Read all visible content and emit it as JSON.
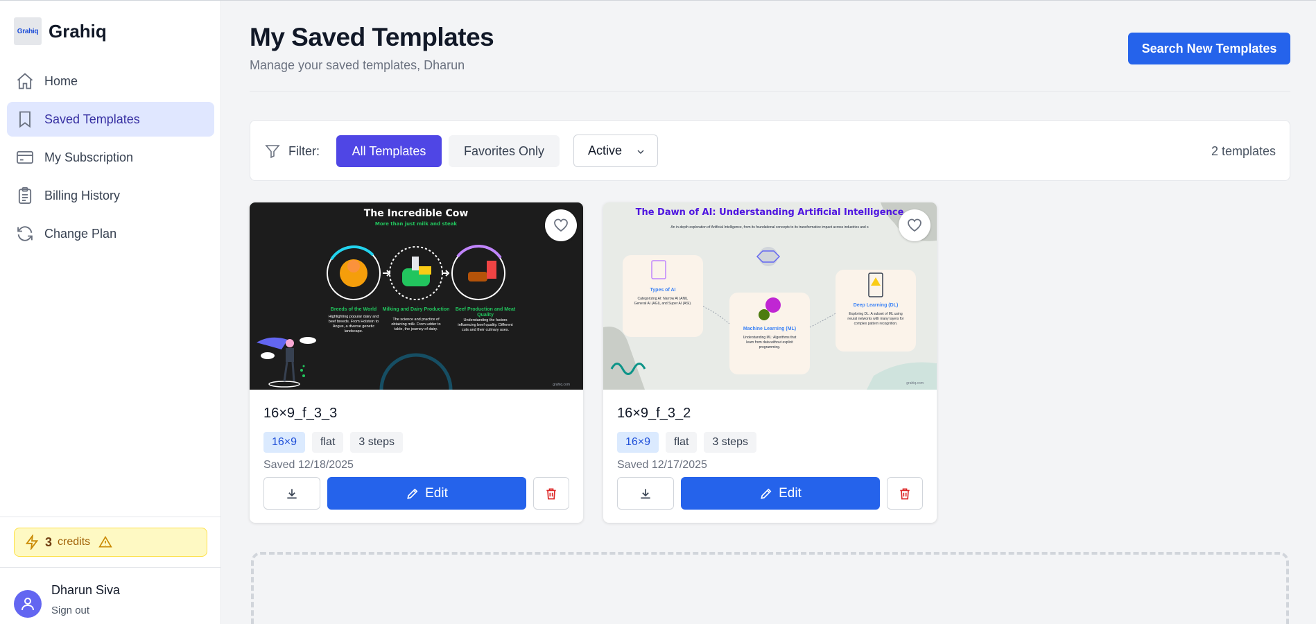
{
  "brand": {
    "logo_text": "Grahiq",
    "name": "Grahiq"
  },
  "nav": [
    {
      "label": "Home",
      "icon": "home-icon",
      "active": false
    },
    {
      "label": "Saved Templates",
      "icon": "bookmark-icon",
      "active": true
    },
    {
      "label": "My Subscription",
      "icon": "credit-card-icon",
      "active": false
    },
    {
      "label": "Billing History",
      "icon": "clipboard-icon",
      "active": false
    },
    {
      "label": "Change Plan",
      "icon": "refresh-icon",
      "active": false
    }
  ],
  "credits": {
    "count": "3",
    "label": "credits"
  },
  "user": {
    "name": "Dharun Siva",
    "signout": "Sign out"
  },
  "header": {
    "title": "My Saved Templates",
    "subtitle": "Manage your saved templates, Dharun",
    "search_button": "Search New Templates"
  },
  "filter": {
    "label": "Filter:",
    "all": "All Templates",
    "favorites": "Favorites Only",
    "status": "Active",
    "count": "2 templates"
  },
  "cards": [
    {
      "name": "16×9_f_3_3",
      "tags": [
        "16×9",
        "flat",
        "3 steps"
      ],
      "saved": "Saved 12/18/2025",
      "edit": "Edit",
      "thumb": {
        "title": "The Incredible Cow",
        "subtitle": "More than just milk and steak",
        "steps": [
          {
            "title": "Breeds of the World",
            "l1": "Highlighting popular dairy and",
            "l2": "beef breeds. From Holstein to",
            "l3": "Angus, a diverse genetic",
            "l4": "landscape."
          },
          {
            "title": "Milking and Dairy Production",
            "l1": "The science and practice of",
            "l2": "obtaining milk. From udder to",
            "l3": "table, the journey of dairy.",
            "l4": ""
          },
          {
            "title": "Beef Production and Meat",
            "title2": "Quality",
            "l1": "Understanding the factors",
            "l2": "influencing beef quality. Different",
            "l3": "cuts and their culinary uses.",
            "l4": ""
          }
        ],
        "footer": "grahiq.com"
      }
    },
    {
      "name": "16×9_f_3_2",
      "tags": [
        "16×9",
        "flat",
        "3 steps"
      ],
      "saved": "Saved 12/17/2025",
      "edit": "Edit",
      "thumb": {
        "title": "The Dawn of AI: Understanding Artificial Intelligence",
        "subtitle": "An in-depth exploration of Artificial Intelligence, from its foundational concepts to its transformative impact across industries and s",
        "steps": [
          {
            "title": "Types of AI",
            "l1": "Categorizing AI: Narrow AI (ANI),",
            "l2": "General AI (AGI), and Super AI (ASI).",
            "l3": ""
          },
          {
            "title": "Machine Learning (ML)",
            "l1": "Understanding ML: Algorithms that",
            "l2": "learn from data without explicit",
            "l3": "programming."
          },
          {
            "title": "Deep Learning (DL)",
            "l1": "Exploring DL: A subset of ML using",
            "l2": "neural networks with many layers for",
            "l3": "complex pattern recognition."
          }
        ],
        "footer": "grahiq.com"
      }
    }
  ],
  "colors": {
    "accent": "#2563eb",
    "active_chip": "#4f46e5",
    "nav_active_bg": "#e0e7ff"
  }
}
